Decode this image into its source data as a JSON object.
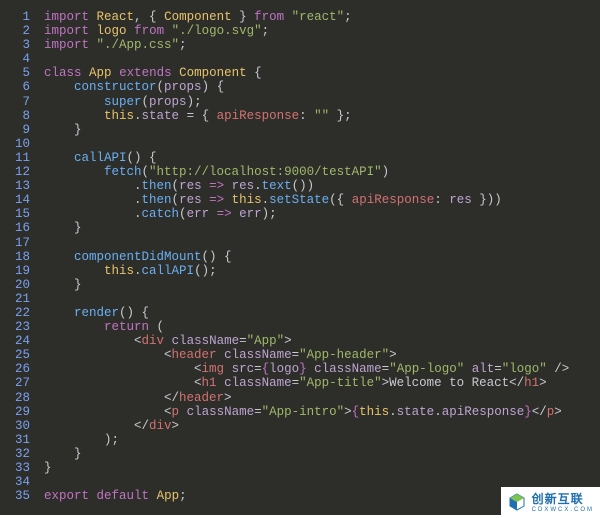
{
  "watermark": {
    "main": "创新互联",
    "sub": "CDXWCX.COM"
  },
  "lines": [
    {
      "n": 1,
      "tokens": [
        [
          "kw",
          "import"
        ],
        [
          "def",
          " "
        ],
        [
          "obj",
          "React"
        ],
        [
          "def",
          ", { "
        ],
        [
          "obj",
          "Component"
        ],
        [
          "def",
          " } "
        ],
        [
          "kw",
          "from"
        ],
        [
          "def",
          " "
        ],
        [
          "str",
          "\"react\""
        ],
        [
          "def",
          ";"
        ]
      ]
    },
    {
      "n": 2,
      "tokens": [
        [
          "kw",
          "import"
        ],
        [
          "def",
          " "
        ],
        [
          "obj",
          "logo"
        ],
        [
          "def",
          " "
        ],
        [
          "kw",
          "from"
        ],
        [
          "def",
          " "
        ],
        [
          "str",
          "\"./logo.svg\""
        ],
        [
          "def",
          ";"
        ]
      ]
    },
    {
      "n": 3,
      "tokens": [
        [
          "kw",
          "import"
        ],
        [
          "def",
          " "
        ],
        [
          "str",
          "\"./App.css\""
        ],
        [
          "def",
          ";"
        ]
      ]
    },
    {
      "n": 4,
      "tokens": []
    },
    {
      "n": 5,
      "tokens": [
        [
          "kw",
          "class"
        ],
        [
          "def",
          " "
        ],
        [
          "obj",
          "App"
        ],
        [
          "def",
          " "
        ],
        [
          "kw",
          "extends"
        ],
        [
          "def",
          " "
        ],
        [
          "obj",
          "Component"
        ],
        [
          "def",
          " {"
        ]
      ]
    },
    {
      "n": 6,
      "tokens": [
        [
          "def",
          "    "
        ],
        [
          "fn",
          "constructor"
        ],
        [
          "def",
          "("
        ],
        [
          "var",
          "props"
        ],
        [
          "def",
          ") {"
        ]
      ]
    },
    {
      "n": 7,
      "tokens": [
        [
          "def",
          "        "
        ],
        [
          "fn",
          "super"
        ],
        [
          "def",
          "("
        ],
        [
          "var",
          "props"
        ],
        [
          "def",
          ");"
        ]
      ]
    },
    {
      "n": 8,
      "tokens": [
        [
          "def",
          "        "
        ],
        [
          "obj",
          "this"
        ],
        [
          "def",
          "."
        ],
        [
          "var",
          "state"
        ],
        [
          "def",
          " = { "
        ],
        [
          "prop",
          "apiResponse"
        ],
        [
          "def",
          ": "
        ],
        [
          "str",
          "\"\""
        ],
        [
          "def",
          " };"
        ]
      ]
    },
    {
      "n": 9,
      "tokens": [
        [
          "def",
          "    }"
        ]
      ]
    },
    {
      "n": 10,
      "tokens": []
    },
    {
      "n": 11,
      "tokens": [
        [
          "def",
          "    "
        ],
        [
          "fn",
          "callAPI"
        ],
        [
          "def",
          "() {"
        ]
      ]
    },
    {
      "n": 12,
      "tokens": [
        [
          "def",
          "        "
        ],
        [
          "fn",
          "fetch"
        ],
        [
          "def",
          "("
        ],
        [
          "str",
          "\"http://localhost:9000/testAPI\""
        ],
        [
          "def",
          ")"
        ]
      ]
    },
    {
      "n": 13,
      "tokens": [
        [
          "def",
          "            ."
        ],
        [
          "fn",
          "then"
        ],
        [
          "def",
          "("
        ],
        [
          "var",
          "res"
        ],
        [
          "def",
          " "
        ],
        [
          "kw",
          "=>"
        ],
        [
          "def",
          " "
        ],
        [
          "var",
          "res"
        ],
        [
          "def",
          "."
        ],
        [
          "fn",
          "text"
        ],
        [
          "def",
          "())"
        ]
      ]
    },
    {
      "n": 14,
      "tokens": [
        [
          "def",
          "            ."
        ],
        [
          "fn",
          "then"
        ],
        [
          "def",
          "("
        ],
        [
          "var",
          "res"
        ],
        [
          "def",
          " "
        ],
        [
          "kw",
          "=>"
        ],
        [
          "def",
          " "
        ],
        [
          "obj",
          "this"
        ],
        [
          "def",
          "."
        ],
        [
          "fn",
          "setState"
        ],
        [
          "def",
          "({ "
        ],
        [
          "prop",
          "apiResponse"
        ],
        [
          "def",
          ": "
        ],
        [
          "var",
          "res"
        ],
        [
          "def",
          " }))"
        ]
      ]
    },
    {
      "n": 15,
      "tokens": [
        [
          "def",
          "            ."
        ],
        [
          "fn",
          "catch"
        ],
        [
          "def",
          "("
        ],
        [
          "var",
          "err"
        ],
        [
          "def",
          " "
        ],
        [
          "kw",
          "=>"
        ],
        [
          "def",
          " "
        ],
        [
          "var",
          "err"
        ],
        [
          "def",
          ");"
        ]
      ]
    },
    {
      "n": 16,
      "tokens": [
        [
          "def",
          "    }"
        ]
      ]
    },
    {
      "n": 17,
      "tokens": []
    },
    {
      "n": 18,
      "tokens": [
        [
          "def",
          "    "
        ],
        [
          "fn",
          "componentDidMount"
        ],
        [
          "def",
          "() {"
        ]
      ]
    },
    {
      "n": 19,
      "tokens": [
        [
          "def",
          "        "
        ],
        [
          "obj",
          "this"
        ],
        [
          "def",
          "."
        ],
        [
          "fn",
          "callAPI"
        ],
        [
          "def",
          "();"
        ]
      ]
    },
    {
      "n": 20,
      "tokens": [
        [
          "def",
          "    }"
        ]
      ]
    },
    {
      "n": 21,
      "tokens": []
    },
    {
      "n": 22,
      "tokens": [
        [
          "def",
          "    "
        ],
        [
          "fn",
          "render"
        ],
        [
          "def",
          "() {"
        ]
      ]
    },
    {
      "n": 23,
      "tokens": [
        [
          "def",
          "        "
        ],
        [
          "kw",
          "return"
        ],
        [
          "def",
          " ("
        ]
      ]
    },
    {
      "n": 24,
      "tokens": [
        [
          "def",
          "            <"
        ],
        [
          "tag",
          "div"
        ],
        [
          "def",
          " "
        ],
        [
          "attr",
          "className"
        ],
        [
          "def",
          "="
        ],
        [
          "str",
          "\"App\""
        ],
        [
          "def",
          ">"
        ]
      ]
    },
    {
      "n": 25,
      "tokens": [
        [
          "def",
          "                <"
        ],
        [
          "tag",
          "header"
        ],
        [
          "def",
          " "
        ],
        [
          "attr",
          "className"
        ],
        [
          "def",
          "="
        ],
        [
          "str",
          "\"App-header\""
        ],
        [
          "def",
          ">"
        ]
      ]
    },
    {
      "n": 26,
      "tokens": [
        [
          "def",
          "                    <"
        ],
        [
          "tag",
          "img"
        ],
        [
          "def",
          " "
        ],
        [
          "attr",
          "src"
        ],
        [
          "def",
          "="
        ],
        [
          "pink",
          "{"
        ],
        [
          "var",
          "logo"
        ],
        [
          "pink",
          "}"
        ],
        [
          "def",
          " "
        ],
        [
          "attr",
          "className"
        ],
        [
          "def",
          "="
        ],
        [
          "str",
          "\"App-logo\""
        ],
        [
          "def",
          " "
        ],
        [
          "attr",
          "alt"
        ],
        [
          "def",
          "="
        ],
        [
          "str",
          "\"logo\""
        ],
        [
          "def",
          " />"
        ]
      ]
    },
    {
      "n": 27,
      "tokens": [
        [
          "def",
          "                    <"
        ],
        [
          "tag",
          "h1"
        ],
        [
          "def",
          " "
        ],
        [
          "attr",
          "className"
        ],
        [
          "def",
          "="
        ],
        [
          "str",
          "\"App-title\""
        ],
        [
          "def",
          ">Welcome to React</"
        ],
        [
          "tag",
          "h1"
        ],
        [
          "def",
          ">"
        ]
      ]
    },
    {
      "n": 28,
      "tokens": [
        [
          "def",
          "                </"
        ],
        [
          "tag",
          "header"
        ],
        [
          "def",
          ">"
        ]
      ]
    },
    {
      "n": 29,
      "tokens": [
        [
          "def",
          "                <"
        ],
        [
          "tag",
          "p"
        ],
        [
          "def",
          " "
        ],
        [
          "attr",
          "className"
        ],
        [
          "def",
          "="
        ],
        [
          "str",
          "\"App-intro\""
        ],
        [
          "def",
          ">"
        ],
        [
          "pink",
          "{"
        ],
        [
          "obj",
          "this"
        ],
        [
          "def",
          "."
        ],
        [
          "var",
          "state"
        ],
        [
          "def",
          "."
        ],
        [
          "var",
          "apiResponse"
        ],
        [
          "pink",
          "}"
        ],
        [
          "def",
          "</"
        ],
        [
          "tag",
          "p"
        ],
        [
          "def",
          ">"
        ]
      ]
    },
    {
      "n": 30,
      "tokens": [
        [
          "def",
          "            </"
        ],
        [
          "tag",
          "div"
        ],
        [
          "def",
          ">"
        ]
      ]
    },
    {
      "n": 31,
      "tokens": [
        [
          "def",
          "        );"
        ]
      ]
    },
    {
      "n": 32,
      "tokens": [
        [
          "def",
          "    }"
        ]
      ]
    },
    {
      "n": 33,
      "tokens": [
        [
          "def",
          "}"
        ]
      ]
    },
    {
      "n": 34,
      "tokens": []
    },
    {
      "n": 35,
      "tokens": [
        [
          "kw",
          "export"
        ],
        [
          "def",
          " "
        ],
        [
          "kw",
          "default"
        ],
        [
          "def",
          " "
        ],
        [
          "obj",
          "App"
        ],
        [
          "def",
          ";"
        ]
      ]
    }
  ]
}
